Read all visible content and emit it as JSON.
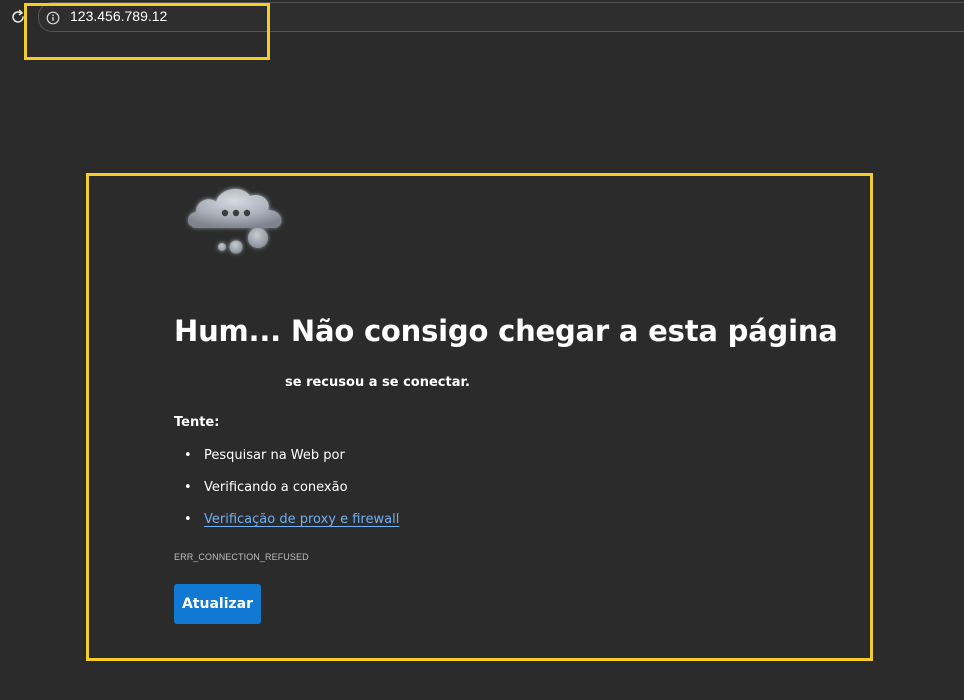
{
  "address_bar": {
    "url": "123.456.789.12",
    "reload_icon": "reload-icon",
    "site_info_icon": "info-icon"
  },
  "error_page": {
    "illustration_icon": "cloud-icon",
    "title": "Hum... Não consigo chegar a esta página",
    "host": "",
    "refused_message": "se recusou a se conectar.",
    "try_label": "Tente:",
    "suggestions": [
      {
        "label": "Pesquisar na Web por",
        "is_link": false
      },
      {
        "label": "Verificando a conexão",
        "is_link": false
      },
      {
        "label": "Verificação de proxy e firewall",
        "is_link": true
      }
    ],
    "error_code": "ERR_CONNECTION_REFUSED",
    "refresh_button_label": "Atualizar"
  },
  "colors": {
    "background": "#2b2b2b",
    "link": "#6fb0f2",
    "primary_button": "#1178d4",
    "highlight": "#f5cd2a"
  }
}
